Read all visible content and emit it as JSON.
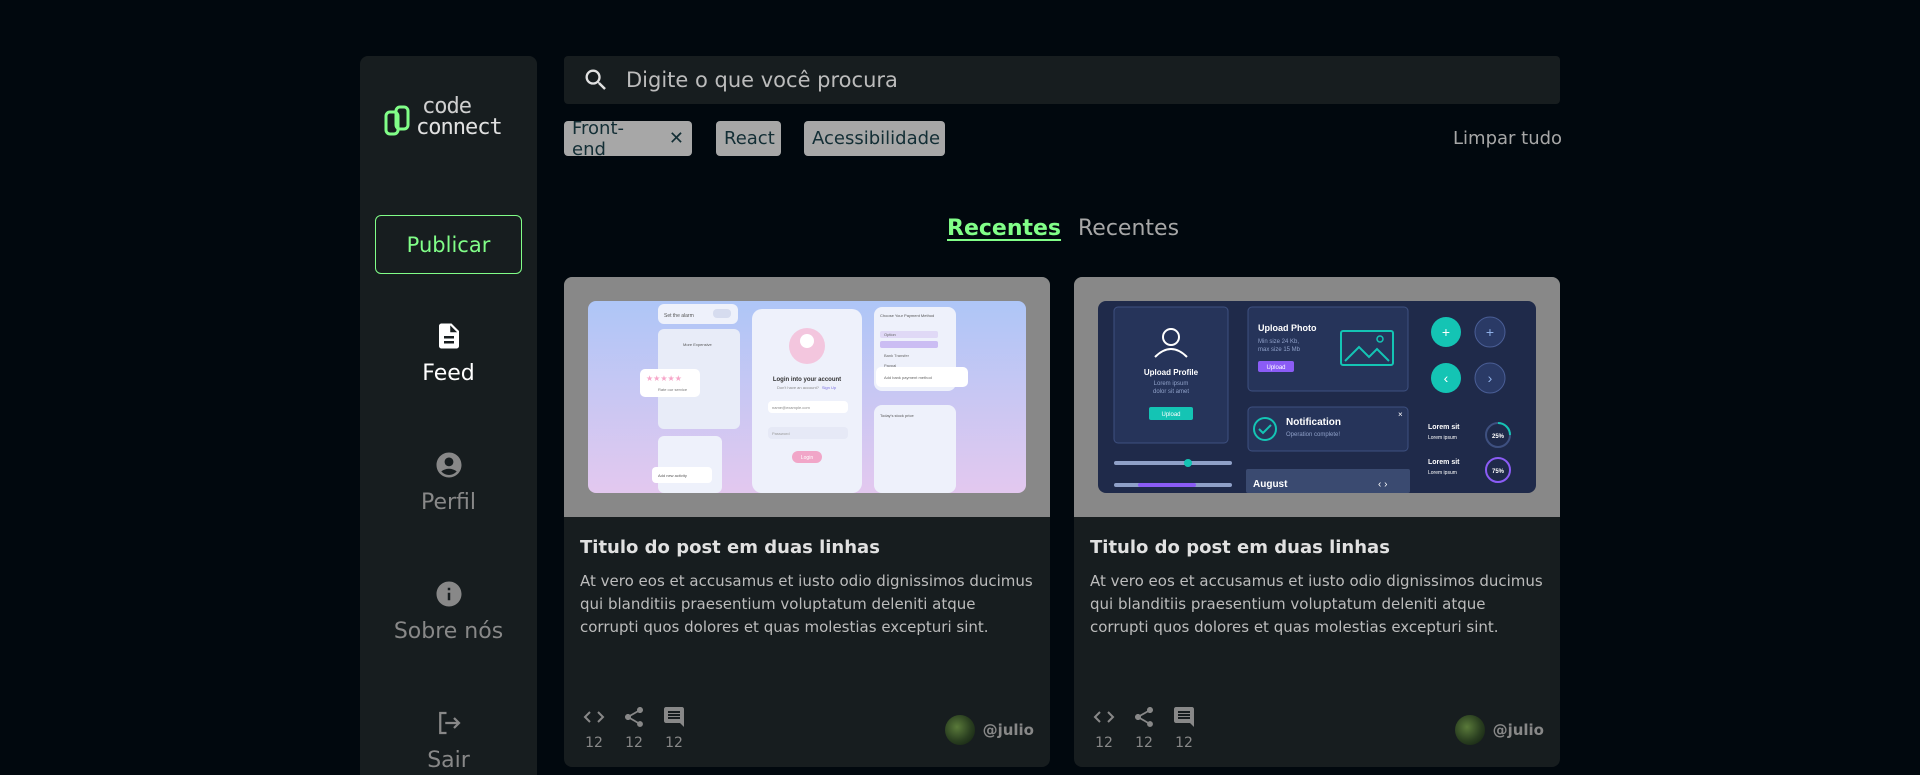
{
  "sidebar": {
    "logo": {
      "line1": "code",
      "line2": "connect"
    },
    "publish_label": "Publicar",
    "items": [
      {
        "label": "Feed",
        "icon": "document-icon",
        "active": true
      },
      {
        "label": "Perfil",
        "icon": "account-circle-icon",
        "active": false
      },
      {
        "label": "Sobre nós",
        "icon": "info-icon",
        "active": false
      },
      {
        "label": "Sair",
        "icon": "logout-icon",
        "active": false
      }
    ]
  },
  "search": {
    "placeholder": "Digite o que você procura",
    "value": ""
  },
  "filters": {
    "tags": [
      "Front-end",
      "React",
      "Acessibilidade"
    ],
    "clear_label": "Limpar tudo"
  },
  "tabs": [
    {
      "label": "Recentes",
      "active": true
    },
    {
      "label": "Recentes",
      "active": false
    }
  ],
  "cards": [
    {
      "title": "Titulo do post em duas linhas",
      "body": "At vero eos et accusamus et iusto odio dignissimos ducimus qui blanditiis praesentium voluptatum deleniti atque corrupti quos dolores et quas molestias excepturi sint.",
      "code_count": "12",
      "share_count": "12",
      "comment_count": "12",
      "author": "@julio",
      "thumbnail": {
        "set_alarm": "Set the alarm",
        "more_expensive": "More Expensive",
        "login_title": "Login into your account",
        "no_account": "Don't have an account?",
        "sign_up": "Sign Up",
        "email": "name@example.com",
        "password": "Password",
        "login_button": "Login",
        "rate_service": "Rate our service",
        "payment_method": "Choose Your Payment Method",
        "option1": "Option",
        "option2": "Bank Transfer",
        "option3": "Paypal",
        "add_bank": "Add bank payment method",
        "todays_stock": "Today's stock price",
        "add_activity": "Add new activity"
      }
    },
    {
      "title": "Titulo do post em duas linhas",
      "body": "At vero eos et accusamus et iusto odio dignissimos ducimus qui blanditiis praesentium voluptatum deleniti atque corrupti quos dolores et quas molestias excepturi sint.",
      "code_count": "12",
      "share_count": "12",
      "comment_count": "12",
      "author": "@julio",
      "thumbnail": {
        "upload_profile": "Upload Profile",
        "lorem_ipsum": "Lorem ipsum",
        "dolor_sit_amet": "dolor sit amet",
        "upload_btn": "Upload",
        "upload_photo": "Upload Photo",
        "min_size": "Min size 24 Kb,",
        "max_size": "max size 15 Mb",
        "notification": "Notification",
        "operation_complete": "Operation complete!",
        "lorem_sit": "Lorem sit",
        "pct_25": "25%",
        "pct_75": "75%",
        "month": "August"
      }
    }
  ],
  "colors": {
    "background": "#01080e",
    "surface": "#171d1f",
    "accent": "#81fe88",
    "tag": "#a7a7a7",
    "muted": "#888888"
  }
}
